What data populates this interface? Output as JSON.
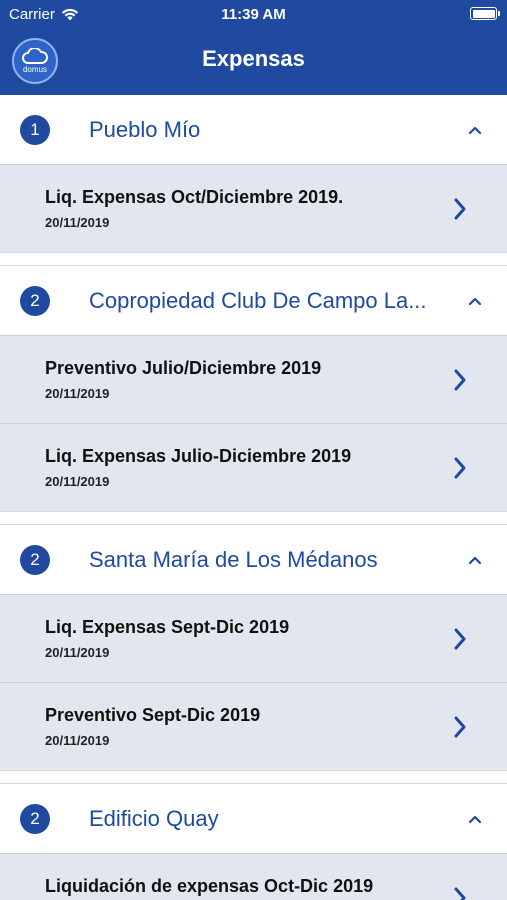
{
  "status": {
    "carrier": "Carrier",
    "time": "11:39 AM"
  },
  "nav": {
    "title": "Expensas",
    "logo_text": "domus"
  },
  "colors": {
    "brand": "#1f4aa0",
    "row_bg": "#e2e7ef"
  },
  "groups": [
    {
      "count": "1",
      "name": "Pueblo Mío",
      "items": [
        {
          "title": "Liq. Expensas Oct/Diciembre 2019.",
          "date": "20/11/2019"
        }
      ]
    },
    {
      "count": "2",
      "name": "Copropiedad Club De Campo La...",
      "items": [
        {
          "title": "Preventivo Julio/Diciembre 2019",
          "date": "20/11/2019"
        },
        {
          "title": "Liq. Expensas Julio-Diciembre 2019",
          "date": "20/11/2019"
        }
      ]
    },
    {
      "count": "2",
      "name": "Santa María de Los Médanos",
      "items": [
        {
          "title": "Liq. Expensas Sept-Dic 2019",
          "date": "20/11/2019"
        },
        {
          "title": "Preventivo Sept-Dic 2019",
          "date": "20/11/2019"
        }
      ]
    },
    {
      "count": "2",
      "name": "Edificio Quay",
      "items": [
        {
          "title": "Liquidación de expensas Oct-Dic 2019",
          "date": ""
        }
      ]
    }
  ]
}
